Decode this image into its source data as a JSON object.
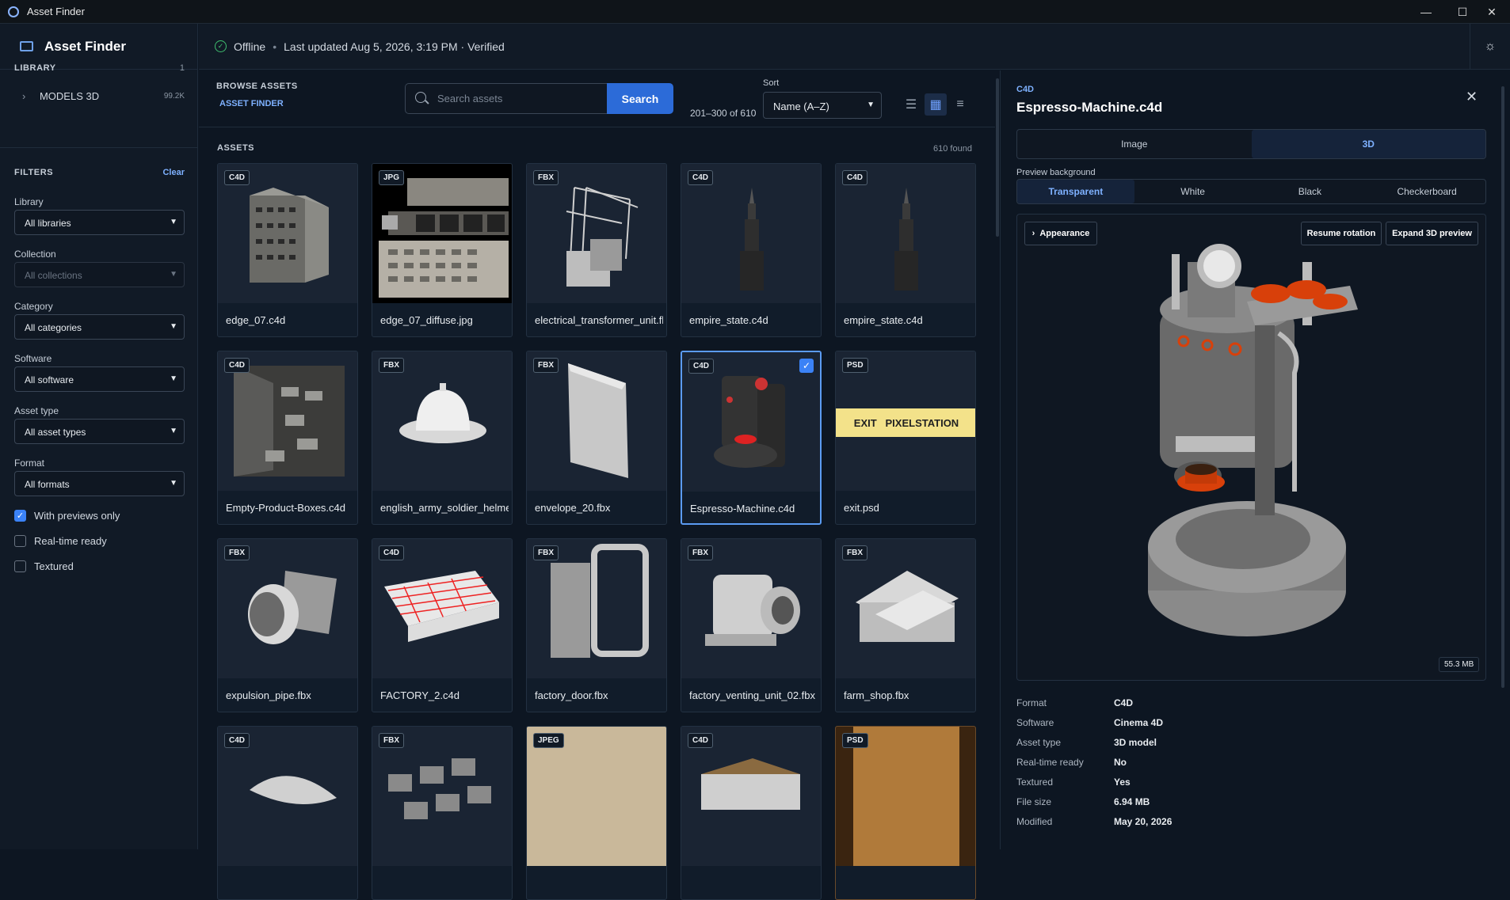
{
  "window": {
    "title": "Asset Finder",
    "controls": [
      "—",
      "☐",
      "✕"
    ]
  },
  "sidebar": {
    "app_name": "Asset Finder",
    "library_title": "LIBRARY",
    "library_count": "1",
    "library_item": {
      "label": "MODELS 3D",
      "size": "99.2K"
    },
    "filters_title": "FILTERS",
    "clear_label": "Clear",
    "filters": [
      {
        "label": "Library",
        "value": "All libraries",
        "disabled": false
      },
      {
        "label": "Collection",
        "value": "All collections",
        "disabled": true
      },
      {
        "label": "Category",
        "value": "All categories",
        "disabled": false
      },
      {
        "label": "Software",
        "value": "All software",
        "disabled": false
      },
      {
        "label": "Asset type",
        "value": "All asset types",
        "disabled": false
      },
      {
        "label": "Format",
        "value": "All formats",
        "disabled": false
      }
    ],
    "checkboxes": [
      {
        "label": "With previews only",
        "checked": true
      },
      {
        "label": "Real-time ready",
        "checked": false
      },
      {
        "label": "Textured",
        "checked": false
      }
    ]
  },
  "status": {
    "state": "Offline",
    "updated": "Last updated Aug 5, 2026, 3:19 PM · Verified"
  },
  "browse": {
    "title": "BROWSE ASSETS",
    "breadcrumb": "ASSET FINDER",
    "search_placeholder": "Search assets",
    "search_button": "Search",
    "range": "201–300 of 610",
    "sort_label": "Sort",
    "sort_value": "Name (A–Z)"
  },
  "assets": {
    "title": "ASSETS",
    "found": "610 found",
    "items": [
      {
        "format": "C4D",
        "name": "edge_07.c4d"
      },
      {
        "format": "JPG",
        "name": "edge_07_diffuse.jpg"
      },
      {
        "format": "FBX",
        "name": "electrical_transformer_unit.fbx"
      },
      {
        "format": "C4D",
        "name": "empire_state.c4d"
      },
      {
        "format": "C4D",
        "name": "empire_state.c4d"
      },
      {
        "format": "C4D",
        "name": "Empty-Product-Boxes.c4d"
      },
      {
        "format": "FBX",
        "name": "english_army_soldier_helmet.fbx"
      },
      {
        "format": "FBX",
        "name": "envelope_20.fbx"
      },
      {
        "format": "C4D",
        "name": "Espresso-Machine.c4d",
        "selected": true
      },
      {
        "format": "PSD",
        "name": "exit.psd"
      },
      {
        "format": "FBX",
        "name": "expulsion_pipe.fbx"
      },
      {
        "format": "C4D",
        "name": "FACTORY_2.c4d"
      },
      {
        "format": "FBX",
        "name": "factory_door.fbx"
      },
      {
        "format": "FBX",
        "name": "factory_venting_unit_02.fbx"
      },
      {
        "format": "FBX",
        "name": "farm_shop.fbx"
      },
      {
        "format": "C4D",
        "name": ""
      },
      {
        "format": "FBX",
        "name": ""
      },
      {
        "format": "JPEG",
        "name": ""
      },
      {
        "format": "C4D",
        "name": ""
      },
      {
        "format": "PSD",
        "name": ""
      }
    ],
    "exit_sign_text": "EXIT   PIXELSTATION"
  },
  "detail": {
    "format": "C4D",
    "title": "Espresso-Machine.c4d",
    "tabs": [
      "Image",
      "3D"
    ],
    "preview_bg_label": "Preview background",
    "bg_options": [
      "Transparent",
      "White",
      "Black",
      "Checkerboard"
    ],
    "appearance_btn": "Appearance",
    "resume_btn": "Resume rotation",
    "expand_btn": "Expand 3D preview",
    "size_badge": "55.3 MB",
    "props": [
      {
        "k": "Format",
        "v": "C4D"
      },
      {
        "k": "Software",
        "v": "Cinema 4D"
      },
      {
        "k": "Asset type",
        "v": "3D model"
      },
      {
        "k": "Real-time ready",
        "v": "No"
      },
      {
        "k": "Textured",
        "v": "Yes"
      },
      {
        "k": "File size",
        "v": "6.94 MB"
      },
      {
        "k": "Modified",
        "v": "May 20, 2026"
      }
    ]
  },
  "colors": {
    "accent": "#2c6bd8",
    "link": "#7eb1ff",
    "ok": "#3fbf6f",
    "bg": "#0d1622",
    "panel": "#111a26"
  }
}
